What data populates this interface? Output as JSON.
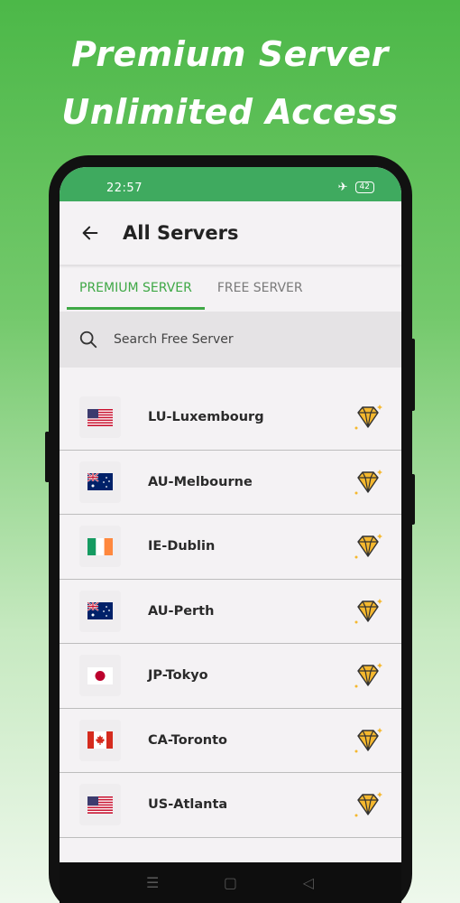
{
  "promo": {
    "line1": "Premium Server",
    "line2": "Unlimited Access"
  },
  "status": {
    "time": "22:57",
    "battery": "42",
    "airplane_icon": "airplane-icon"
  },
  "appbar": {
    "title": "All Servers",
    "back_icon": "arrow-left-icon"
  },
  "tabs": [
    {
      "label": "PREMIUM SERVER",
      "active": true
    },
    {
      "label": "FREE SERVER",
      "active": false
    }
  ],
  "search": {
    "placeholder": "Search Free Server",
    "icon": "search-icon"
  },
  "servers": [
    {
      "name": "LU-Luxembourg",
      "flag": "us"
    },
    {
      "name": "AU-Melbourne",
      "flag": "au"
    },
    {
      "name": "IE-Dublin",
      "flag": "ie"
    },
    {
      "name": "AU-Perth",
      "flag": "au"
    },
    {
      "name": "JP-Tokyo",
      "flag": "jp"
    },
    {
      "name": "CA-Toronto",
      "flag": "ca"
    },
    {
      "name": "US-Atlanta",
      "flag": "us"
    }
  ],
  "colors": {
    "accent": "#3fa846",
    "statusbar": "#3faa5f",
    "gem": "#f5b82e"
  }
}
